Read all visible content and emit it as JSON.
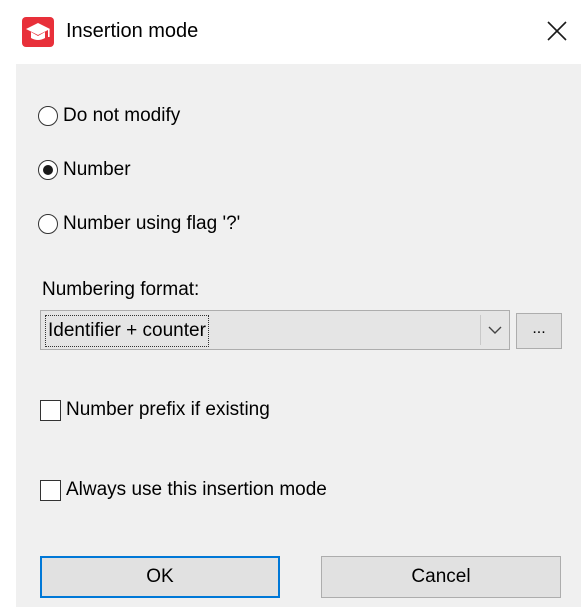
{
  "window": {
    "title": "Insertion mode",
    "app_icon": "graduation-cap-icon",
    "close_icon": "close-icon"
  },
  "options": [
    {
      "label": "Do not modify",
      "checked": false
    },
    {
      "label": "Number",
      "checked": true
    },
    {
      "label": "Number using flag '?'",
      "checked": false
    }
  ],
  "numbering": {
    "label": "Numbering format:",
    "selected": "Identifier + counter",
    "dropdown_icon": "chevron-down-icon",
    "browse_label": "..."
  },
  "checkboxes": {
    "prefix_label": "Number prefix if existing",
    "prefix_checked": false,
    "always_label": "Always use this insertion mode",
    "always_checked": false
  },
  "buttons": {
    "ok_label": "OK",
    "cancel_label": "Cancel"
  },
  "colors": {
    "app_icon_red": "#e8303a",
    "default_button_border": "#0078d7",
    "client_background": "#f0f0f0"
  }
}
